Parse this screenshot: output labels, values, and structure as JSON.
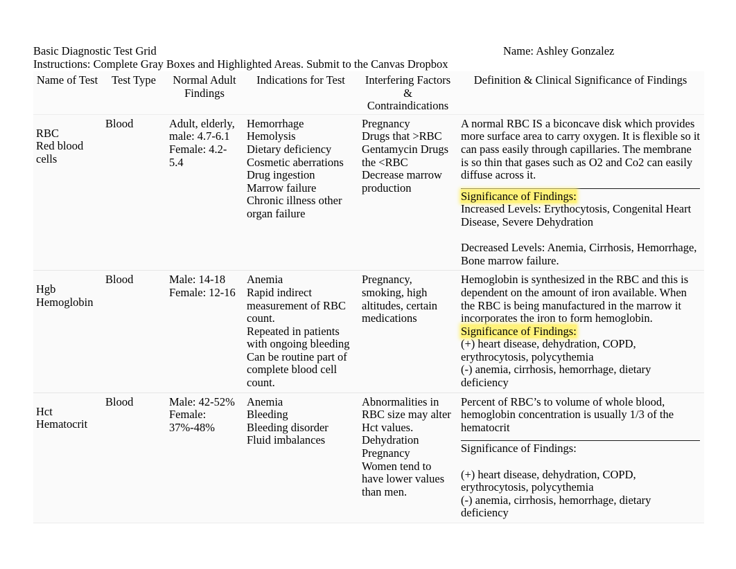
{
  "document": {
    "title": "Basic Diagnostic Test Grid",
    "instructions": "Instructions: Complete Gray Boxes and Highlighted Areas. Submit to the Canvas Dropbox",
    "name_field": "Name: Ashley Gonzalez"
  },
  "table": {
    "headers": {
      "name_of_test": "Name of Test",
      "test_type": "Test Type",
      "normal_adult_findings": "Normal Adult Findings",
      "indications_for_test": "Indications for Test",
      "interfering_factors": "Interfering Factors & Contraindications",
      "definition": "Definition & Clinical Significance of Findings"
    },
    "rows": [
      {
        "name_abbr": "RBC",
        "name_full": "Red blood cells",
        "test_type": "Blood",
        "normal_findings": "Adult, elderly, male: 4.7-6.1\nFemale: 4.2-5.4",
        "indications": "Hemorrhage\nHemolysis\nDietary deficiency\nCosmetic aberrations\nDrug ingestion\nMarrow failure\nChronic illness other organ failure",
        "interfering": "Pregnancy\nDrugs that >RBC\nGentamycin Drugs the <RBC\nDecrease marrow production",
        "definition": "A normal RBC IS a biconcave disk which provides more surface area to carry oxygen. It is flexible so it can pass easily through capillaries. The membrane is so thin that gases such as O2 and Co2 can easily diffuse across it.",
        "has_rule": true,
        "significance_label": "Significance of Findings:",
        "significance_highlighted": true,
        "significance_lines": [
          "Increased Levels: Erythocytosis, Congenital Heart Disease, Severe Dehydration",
          "",
          "Decreased Levels: Anemia, Cirrhosis, Hemorrhage, Bone marrow failure."
        ]
      },
      {
        "name_abbr": "Hgb",
        "name_full": "Hemoglobin",
        "test_type": "Blood",
        "normal_findings": "Male: 14-18\nFemale: 12-16",
        "indications": "Anemia\nRapid indirect measurement of RBC count.\nRepeated in patients with ongoing bleeding\nCan be routine part of complete blood cell count.",
        "interfering": "Pregnancy, smoking, high altitudes, certain medications",
        "definition": "Hemoglobin is synthesized in the RBC and this is dependent on the amount of iron available. When the RBC is being manufactured in the marrow it incorporates the iron to form hemoglobin.",
        "has_rule": false,
        "significance_label": "Significance of Findings:",
        "significance_highlighted": true,
        "significance_lines": [
          "(+) heart disease, dehydration, COPD, erythrocytosis, polycythemia",
          "(-) anemia, cirrhosis, hemorrhage, dietary deficiency"
        ]
      },
      {
        "name_abbr": "Hct",
        "name_full": "Hematocrit",
        "test_type": "Blood",
        "normal_findings": "Male: 42-52%\nFemale: 37%-48%",
        "indications": "Anemia\nBleeding\nBleeding disorder\nFluid imbalances",
        "interfering": "Abnormalities in RBC size may alter Hct values.\nDehydration\nPregnancy\nWomen tend to have lower values than men.",
        "definition": "Percent of RBC’s to volume of whole blood, hemoglobin concentration is usually 1/3 of the hematocrit",
        "has_rule": true,
        "significance_label": "Significance of Findings:",
        "significance_highlighted": false,
        "significance_lines": [
          "",
          "(+) heart disease, dehydration, COPD, erythrocytosis, polycythemia",
          "(-) anemia, cirrhosis, hemorrhage, dietary deficiency"
        ]
      }
    ]
  }
}
